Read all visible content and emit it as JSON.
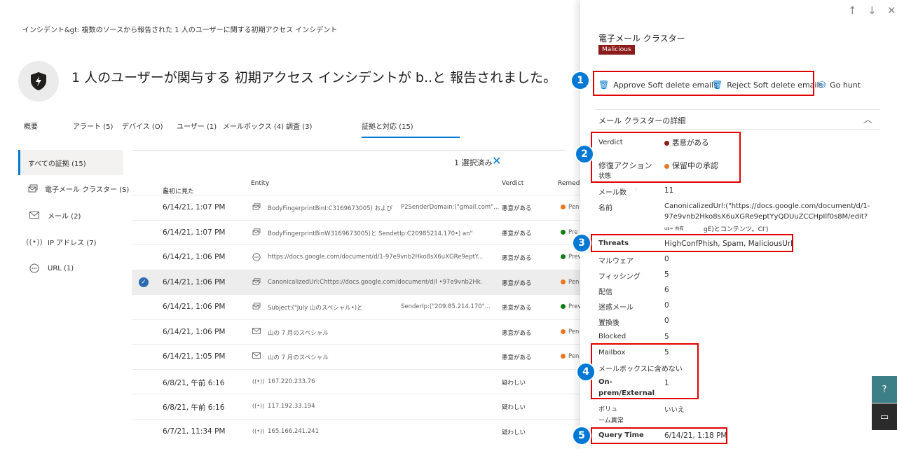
{
  "breadcrumb": "インシデント&gt:  複数のソースから報告された 1 人のユーザーに関する初期アクセス インシデント",
  "page_title": "1 人のユーザーが関与する 初期アクセス インシデントが b..と 報告されました。",
  "tabs": [
    {
      "label": "概要"
    },
    {
      "label": "アラート (5)"
    },
    {
      "label": "デバイス (O)"
    },
    {
      "label": "ユーザー (1)"
    },
    {
      "label": "メールボックス (4)"
    },
    {
      "label": "調査 (3)"
    },
    {
      "label": "証拠と対応 (15)"
    }
  ],
  "sidenav": [
    {
      "label": "すべての証拠 (15)",
      "icon": ""
    },
    {
      "label": "電子メール クラスター (S)",
      "icon": "mail-cluster-icon"
    },
    {
      "label": "メール (2)",
      "icon": "mail-icon"
    },
    {
      "label": "IP アドレス (7)",
      "icon": "ip-broadcast-icon"
    },
    {
      "label": "URL (1)",
      "icon": "url-icon"
    }
  ],
  "selection": {
    "text": "1 選択済み"
  },
  "grid": {
    "headers": {
      "first_seen": "最初に見た",
      "entity": "Entity",
      "verdict": "Verdict",
      "remediation": "Remedi"
    },
    "rows": [
      {
        "date": "6/14/21, 1:07 PM",
        "icon": "mail-cluster-icon",
        "entity": "BodyFingerprintBinI:C3169673005) および",
        "entity2": "P2SenderDomain:(\"gmail.com\"...",
        "verdict": "悪意がある",
        "rem": "Pen",
        "rem_color": "#e87722",
        "selected": false
      },
      {
        "date": "6/14/21, 1:07 PM",
        "icon": "mail-cluster-icon",
        "entity": "BodyFingerprintBinW3169673005)と SendetIp:C20985214.170•) an\"",
        "entity2": "",
        "verdict": "悪意がある",
        "rem": "Pre",
        "rem_color": "#107c10",
        "selected": false
      },
      {
        "date": "6/14/21, 1:06 PM",
        "icon": "url-icon",
        "entity": "https://docs.google.com/document/d/1-97e9vnb2Hko8sX6uXGRe9eptY...",
        "entity2": "",
        "verdict": "悪意がある",
        "rem": "Prev",
        "rem_color": "#107c10",
        "selected": false
      },
      {
        "date": "6/14/21, 1:06 PM",
        "icon": "mail-cluster-icon",
        "entity": "CanonicalizedUrl:Chttps://docs.google.com/document/d/I •97e9vnb2Hk.",
        "entity2": "",
        "verdict": "悪意がある",
        "rem": "Pen",
        "rem_color": "#e87722",
        "selected": true
      },
      {
        "date": "6/14/21, 1:06 PM",
        "icon": "mail-cluster-icon",
        "entity": "Subject:(\"July 山のスペシャル•)と",
        "entity2": "SenderIp:(\"209.85.214.170\"...",
        "verdict": "悪意がある",
        "rem": "Prev",
        "rem_color": "#107c10",
        "selected": false
      },
      {
        "date": "6/14/21, 1:06 PM",
        "icon": "mail-icon",
        "entity": "山の 7 月のスペシャル",
        "entity2": "",
        "verdict": "悪意がある",
        "rem": "Pen",
        "rem_color": "#e87722",
        "selected": false
      },
      {
        "date": "6/14/21, 1:05 PM",
        "icon": "mail-icon",
        "entity": "山の 7 月のスペシャル",
        "entity2": "",
        "verdict": "悪意がある",
        "rem": "Pen",
        "rem_color": "#e87722",
        "selected": false
      },
      {
        "date": "6/8/21, 午前 6:16",
        "icon": "ip-broadcast-icon",
        "entity": "167.220.233.76",
        "entity2": "",
        "verdict": "疑わしい",
        "rem": "",
        "rem_color": "",
        "selected": false
      },
      {
        "date": "6/8/21, 午前 6:16",
        "icon": "ip-broadcast-icon",
        "entity": "117.192.33.194",
        "entity2": "",
        "verdict": "疑わしい",
        "rem": "",
        "rem_color": "",
        "selected": false
      },
      {
        "date": "6/7/21, 11:34 PM",
        "icon": "ip-broadcast-icon",
        "entity": "165.166.241.241",
        "entity2": "",
        "verdict": "疑わしい",
        "rem": "",
        "rem_color": "",
        "selected": false
      }
    ]
  },
  "panel": {
    "title": "電子メール クラスター",
    "badge": "Malicious",
    "badge_color": "#8b1a1a",
    "actions": {
      "approve": "Approve Soft delete emails",
      "reject": "Reject Soft delete emails",
      "hunt": "Go hunt"
    },
    "section_title": "メール クラスターの詳細",
    "details": {
      "verdict_label": "Verdict",
      "verdict_value": "悪意がある",
      "verdict_color": "#8b1a1a",
      "remediation_label": "修復アクション",
      "remediation_label2": "状態",
      "remediation_value": "保留中の承認",
      "remediation_color": "#e87722",
      "mail_count_label": "メール数",
      "mail_count_sep": ":",
      "mail_count": "11",
      "name_label": "名前",
      "name_value_1": "CanonicalizedUrl:(\"https://docs.google.com/document/d/1-",
      "name_value_2": "97e9vnb2Hko8sX6uXGRe9eptYyQDUuZCCHpIlf0s8M/edit?",
      "name_value_3a": "us= 共有",
      "name_value_3b": "gE)とコンテンツ。CI')",
      "threats_label": "Threats",
      "threats_value": "HighConfPhish, Spam, MaliciousUrl",
      "malware_label": "マルウェア",
      "malware_value": "0",
      "phishing_label": "フィッシング",
      "phishing_value": "5",
      "delivered_label": "配信",
      "delivered_value": "6",
      "junk_label": "迷惑メール",
      "junk_value": "0",
      "replaced_label": "置換後",
      "replaced_value": "0",
      "blocked_label": "Blocked",
      "blocked_value": "5",
      "mailbox_label": "Mailbox",
      "mailbox_value": "5",
      "not_in_mailbox_label": "メールボックスに含めない",
      "onprem_label_1": "On-",
      "onprem_label_2": "prem/External",
      "onprem_value": "1",
      "volume_label_1": "ボリュ",
      "volume_label_2": "ーム異常",
      "volume_value": "いいえ",
      "query_time_label": "Query Time",
      "query_time_value": "6/14/21, 1:18 PM"
    },
    "markers": [
      "1",
      "2",
      "3",
      "4",
      "5"
    ]
  }
}
